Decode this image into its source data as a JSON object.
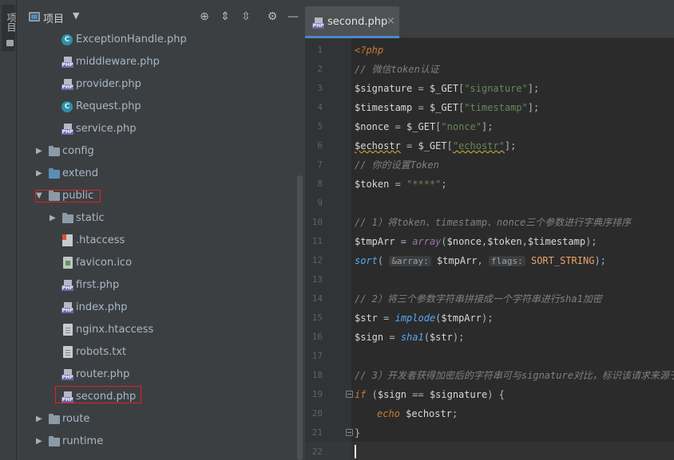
{
  "sidebar_strip": {
    "label": "项目"
  },
  "project_panel": {
    "title": "项目",
    "dropdown_icon": "caret-down-icon",
    "toolbar_icons": [
      "locate-icon",
      "expand-all-icon",
      "collapse-all-icon",
      "gear-icon",
      "minimize-icon"
    ]
  },
  "tree": [
    {
      "name": "ExceptionHandle.php",
      "icon": "class-icon",
      "level": 2
    },
    {
      "name": "middleware.php",
      "icon": "php-file-icon",
      "level": 2
    },
    {
      "name": "provider.php",
      "icon": "php-file-icon",
      "level": 2
    },
    {
      "name": "Request.php",
      "icon": "class-icon",
      "level": 2
    },
    {
      "name": "service.php",
      "icon": "php-file-icon",
      "level": 2
    },
    {
      "name": "config",
      "icon": "folder-icon",
      "level": 1,
      "expanded": false
    },
    {
      "name": "extend",
      "icon": "folder-blue-icon",
      "level": 1,
      "expanded": false
    },
    {
      "name": "public",
      "icon": "folder-icon",
      "level": 1,
      "expanded": true,
      "highlighted": true
    },
    {
      "name": "static",
      "icon": "folder-icon",
      "level": 2,
      "expanded": false
    },
    {
      "name": ".htaccess",
      "icon": "htaccess-icon",
      "level": 2
    },
    {
      "name": "favicon.ico",
      "icon": "image-file-icon",
      "level": 2
    },
    {
      "name": "first.php",
      "icon": "php-file-icon",
      "level": 2
    },
    {
      "name": "index.php",
      "icon": "php-file-icon",
      "level": 2
    },
    {
      "name": "nginx.htaccess",
      "icon": "text-file-icon",
      "level": 2
    },
    {
      "name": "robots.txt",
      "icon": "text-file-icon",
      "level": 2
    },
    {
      "name": "router.php",
      "icon": "php-file-icon",
      "level": 2
    },
    {
      "name": "second.php",
      "icon": "php-file-icon",
      "level": 2,
      "highlighted": true
    },
    {
      "name": "route",
      "icon": "folder-icon",
      "level": 1,
      "expanded": false
    },
    {
      "name": "runtime",
      "icon": "folder-icon",
      "level": 1,
      "expanded": false
    }
  ],
  "editor": {
    "tab": {
      "name": "second.php",
      "close": "×",
      "icon": "php-file-icon"
    },
    "line_numbers": [
      "1",
      "2",
      "3",
      "4",
      "5",
      "6",
      "7",
      "8",
      "9",
      "10",
      "11",
      "12",
      "13",
      "14",
      "15",
      "16",
      "17",
      "18",
      "19",
      "20",
      "21",
      "22"
    ],
    "code": {
      "l1": "<?php",
      "l2": "// 微信token认证",
      "l3a": "$signature",
      "l3b": " = ",
      "l3c": "$_GET",
      "l3d": "[",
      "l3e": "\"signature\"",
      "l3f": "];",
      "l4a": "$timestamp",
      "l4b": " = ",
      "l4c": "$_GET",
      "l4d": "[",
      "l4e": "\"timestamp\"",
      "l4f": "];",
      "l5a": "$nonce",
      "l5b": " = ",
      "l5c": "$_GET",
      "l5d": "[",
      "l5e": "\"nonce\"",
      "l5f": "];",
      "l6a": "$echostr",
      "l6b": " = ",
      "l6c": "$_GET",
      "l6d": "[",
      "l6e": "\"echostr\"",
      "l6f": "];",
      "l7": "// 你的设置Token",
      "l8a": "$token",
      "l8b": " = ",
      "l8c": "\"****\"",
      "l8d": ";",
      "l10": "// 1）将token、timestamp、nonce三个参数进行字典序排序",
      "l11a": "$tmpArr",
      "l11b": " = ",
      "l11c": "array",
      "l11d": "(",
      "l11e": "$nonce",
      "l11f": ",",
      "l11g": "$token",
      "l11h": ",",
      "l11i": "$timestamp",
      "l11j": ");",
      "l12a": "sort",
      "l12b": "( ",
      "l12c": "&array:",
      "l12d": " ",
      "l12e": "$tmpArr",
      "l12f": ", ",
      "l12g": "flags:",
      "l12h": " ",
      "l12i": "SORT_STRING",
      "l12j": ");",
      "l14": "// 2）将三个参数字符串拼接成一个字符串进行sha1加密",
      "l15a": "$str",
      "l15b": " = ",
      "l15c": "implode",
      "l15d": "(",
      "l15e": "$tmpArr",
      "l15f": ");",
      "l16a": "$sign",
      "l16b": " = ",
      "l16c": "sha1",
      "l16d": "(",
      "l16e": "$str",
      "l16f": ");",
      "l18": "// 3）开发者获得加密后的字符串可与signature对比，标识该请求来源于",
      "l19a": "if",
      "l19b": " (",
      "l19c": "$sign",
      "l19d": " == ",
      "l19e": "$signature",
      "l19f": ") {",
      "l20a": "echo",
      "l20b": " ",
      "l20c": "$echostr",
      "l20d": ";",
      "l21": "}"
    }
  }
}
